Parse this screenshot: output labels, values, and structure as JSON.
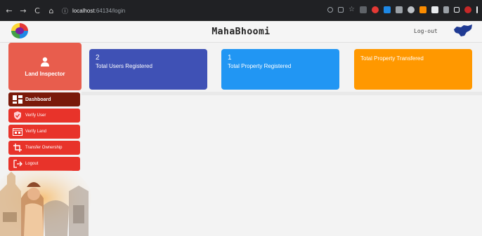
{
  "browser": {
    "back": "←",
    "forward": "→",
    "reload": "C",
    "home": "⌂",
    "info_icon": "ⓘ",
    "url_host": "localhost",
    "url_rest": ":64134/login"
  },
  "header": {
    "title": "MahaBhoomi",
    "logout_label": "Log-out"
  },
  "sidebar": {
    "role": "Land Inspector",
    "items": [
      {
        "label": "Dashboard"
      },
      {
        "label": "Verify User"
      },
      {
        "label": "Verify Land"
      },
      {
        "label": "Transfer Ownership"
      },
      {
        "label": "Logout"
      }
    ]
  },
  "cards": [
    {
      "value": "2",
      "label": "Total Users Registered",
      "color": "#3f51b5"
    },
    {
      "value": "1",
      "label": "Total Property Registered",
      "color": "#2196f3"
    },
    {
      "value": "",
      "label": "Total Property Transfered",
      "color": "#ff9800"
    }
  ],
  "colors": {
    "sidebar_item": "#e8332a",
    "sidebar_active": "#7a1a0a",
    "profile_bg": "#e85d4d"
  }
}
